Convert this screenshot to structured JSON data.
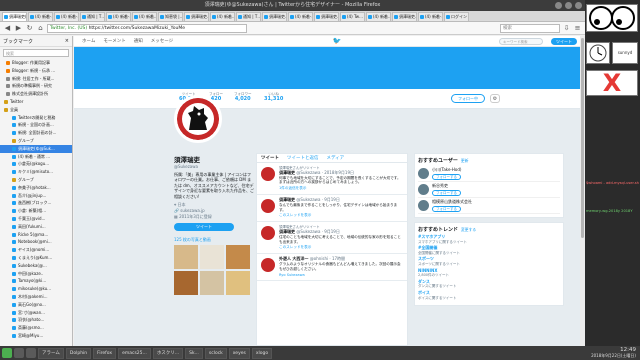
{
  "window": {
    "title": "須澤瑞吏(ゆ@Sukezawa)さん | Twitterから住宅デザイナー - Mozilla Firefox"
  },
  "browser": {
    "url_secure": "Twitter, Inc. (US)",
    "url": "https://twitter.com/SukezawaMizuki_YouMe",
    "search_placeholder": "検索"
  },
  "tabs": [
    "須澤瑞吏(ゆ",
    "(4) 新着-…",
    "(4) 新着-…",
    "通知 | T…",
    "(4) 新着-…",
    "(4) 新着…",
    "知恵袋 |…",
    "須澤瑞吏…",
    "(4) 新着…",
    "通知 | T…",
    "須澤瑞吏…",
    "(4) 新着-…",
    "須澤瑞吏…",
    "(4) Tw…",
    "(4) 新着…",
    "須澤瑞吏…",
    "(4) 新着-…",
    "ログイン"
  ],
  "sidebar": {
    "title": "ブックマーク",
    "search": "検索",
    "items": [
      {
        "label": "Blogger: 作業用記事",
        "color": "#f57d00"
      },
      {
        "label": "Blogger: 新規 - 伝承 ...",
        "color": "#f57d00"
      },
      {
        "label": "新規: 住居工作 - 所蔵...",
        "color": "#888"
      },
      {
        "label": "新規の準備事例 - 研究",
        "color": "#888"
      },
      {
        "label": "株式会社須澤設計所",
        "color": "#888"
      },
      {
        "label": "Twitter",
        "color": "#d4a017"
      },
      {
        "label": "全員",
        "color": "#d4a017"
      },
      {
        "label": "Twitterの開発と税務",
        "color": "#1da1f2"
      },
      {
        "label": "新規 - 全国の計画...",
        "color": "#1da1f2"
      },
      {
        "label": "新規: 全国計画の計...",
        "color": "#1da1f2"
      },
      {
        "label": "グループ",
        "color": "#d4a017"
      },
      {
        "label": "須澤瑞吏(ゆ@Suk...",
        "color": "#1da1f2",
        "selected": true
      },
      {
        "label": "(4) 新着 - 通常 ...",
        "color": "#1da1f2"
      },
      {
        "label": "小倉苑(@kogu...",
        "color": "#1da1f2"
      },
      {
        "label": "キクミ(@misuto...",
        "color": "#1da1f2"
      },
      {
        "label": "グループ",
        "color": "#d4a017"
      },
      {
        "label": "奈美子(@hotak...",
        "color": "#1da1f2"
      },
      {
        "label": "吾介(@jinjup...",
        "color": "#1da1f2"
      },
      {
        "label": "進西樹(ブロック...",
        "color": "#1da1f2"
      },
      {
        "label": "小倉: 新築(相...",
        "color": "#1da1f2"
      },
      {
        "label": "千葉玉(@vid...",
        "color": "#1da1f2"
      },
      {
        "label": "高田(Yukumi...",
        "color": "#1da1f2"
      },
      {
        "label": "Ricke 5(@ma...",
        "color": "#1da1f2"
      },
      {
        "label": "Notebook(@mi...",
        "color": "#1da1f2"
      },
      {
        "label": "ヤイス(@nomi...",
        "color": "#1da1f2"
      },
      {
        "label": "くまえり(@Kum...",
        "color": "#1da1f2"
      },
      {
        "label": "Sukebeka(@...",
        "color": "#1da1f2"
      },
      {
        "label": "中田(@kaze..",
        "color": "#1da1f2"
      },
      {
        "label": "Tamayo(@ki...",
        "color": "#1da1f2"
      },
      {
        "label": "mikosuke(@ku...",
        "color": "#1da1f2"
      },
      {
        "label": "木村(@akemi...",
        "color": "#1da1f2"
      },
      {
        "label": "高石Go(@no...",
        "color": "#1da1f2"
      },
      {
        "label": "宮:寸(@wan...",
        "color": "#1da1f2"
      },
      {
        "label": "羽衣(@hato...",
        "color": "#1da1f2"
      },
      {
        "label": "斎藤(@smo...",
        "color": "#1da1f2"
      },
      {
        "label": "宮崎@Miyu...",
        "color": "#1da1f2"
      }
    ]
  },
  "twitter": {
    "nav": [
      "ホーム",
      "モーメント",
      "通知",
      "メッセージ"
    ],
    "search_placeholder": "キーワード検索",
    "tweet_button": "ツイート",
    "stats": [
      {
        "label": "ツイート",
        "value": "60,300"
      },
      {
        "label": "フォロー",
        "value": "420"
      },
      {
        "label": "フォロワー",
        "value": "4,020"
      },
      {
        "label": "いいね",
        "value": "31,310"
      }
    ],
    "follow_button": "フォロー中",
    "profile": {
      "name": "須澤瑞吏",
      "handle": "@Sukezawa",
      "bio": "所属:「美」専用の事業主体 | アイコンはフォロワーの仕業。お仕事、ご依頼は DM または dm、オススメアカウントなど、住宅デザインで身近な要素を取り入れた作品を、ご相談ください!",
      "location": "日本",
      "link": "sukezawa.jp",
      "joined": "2011年3月に登録",
      "photos": "125 枚の写真と動画"
    },
    "tabs": [
      "ツイート",
      "ツイートと返信",
      "メディア"
    ],
    "tweets": [
      {
        "name": "須澤瑞吏",
        "handle": "@Sukezawa · 2018年9月19日",
        "ctx": "須澤瑞吏さんがリツイート",
        "text": "何事でも地域を大切にすることで、予定の期間を長くすることが大切です。まずは近所の方への挨拶からはじめてみましょう。",
        "action": "1件の返信を表示"
      },
      {
        "name": "須澤瑞吏",
        "handle": "@Sukezawa · 9月19日",
        "ctx": "",
        "text": "なんでも最後まで作ることをしっかり、住宅デザインは地域から始まります。",
        "action": "このスレッドを表示"
      },
      {
        "name": "須澤瑞吏",
        "handle": "@Sukezawa · 9月19日",
        "ctx": "須澤瑞吏さんがリツイート",
        "text": "住宅のことも地域を大切に考えることで、地域の伝統的な家の形を知ることも出来ます。",
        "action": "このスレッドを表示"
      },
      {
        "name": "外遊人 大西洋一",
        "handle": "@ohnishi · 17時間",
        "ctx": "",
        "text": "グラムのようなオリジナルの食器もどんどん増えてきました。次回の展示会もぜひお越しください。",
        "action": "Ryo Sukezawa"
      }
    ],
    "who_to_follow": {
      "title": "おすすめユーザー",
      "refresh": "更新",
      "items": [
        {
          "name": "小川(Take-Hod)",
          "button": "フォローする"
        },
        {
          "name": "新谷秀吏",
          "button": "フォローする"
        },
        {
          "name": "相模原山鉄道株式会社",
          "button": "フォローする"
        }
      ]
    },
    "trends": {
      "title": "おすすめトレンド",
      "change": "変更する",
      "items": [
        {
          "tag": "#スマホアプリ",
          "desc": "スマホアプリに関するツイート"
        },
        {
          "tag": "#全国開催",
          "desc": "全国開催に関するツイート"
        },
        {
          "tag": "スポーツ",
          "desc": "スポーツに関するツイート"
        },
        {
          "tag": "NINNINX",
          "desc": "2,800件のツイート"
        },
        {
          "tag": "ダンス",
          "desc": "ダンスに関するツイート"
        },
        {
          "tag": "ボイス",
          "desc": "ボイスに関するツイート"
        }
      ]
    }
  },
  "taskbar": {
    "tasks": [
      "アラーム",
      "Dolphin",
      "Firefox",
      "emacs25...",
      "ホスクリ...",
      "Sk...",
      "sclock",
      "xeyes",
      "xlogo"
    ],
    "time": "12:49",
    "date": "2018年9月22日(土曜日)"
  },
  "desktop": {
    "window_title": "sunnyd",
    "mark": "X",
    "cmd1": "$whoami - add-mysql-user.sh",
    "cmd2": "memory-wg-2018y 2018Y"
  }
}
